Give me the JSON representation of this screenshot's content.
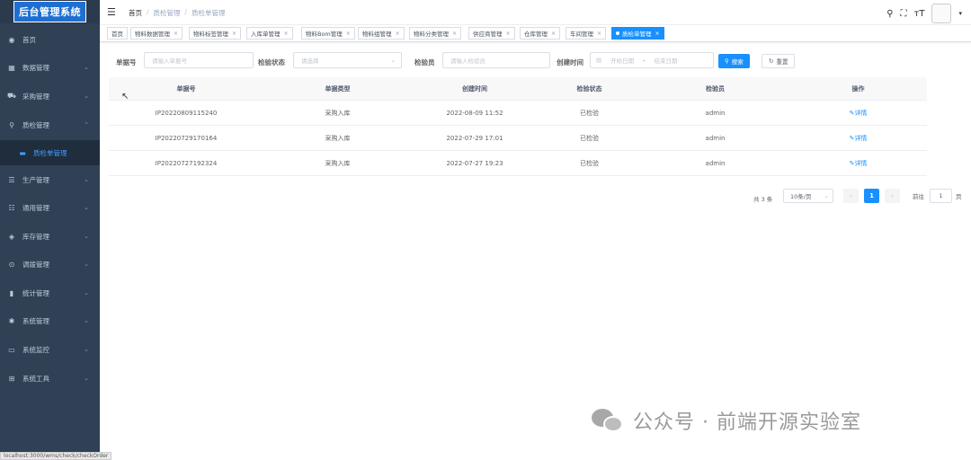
{
  "sidebar": {
    "logo": "后台管理系统",
    "items": [
      {
        "label": "首页",
        "icon": "dashboard-icon",
        "glyph": "◉",
        "chevron": false
      },
      {
        "label": "数据管理",
        "icon": "table-icon",
        "glyph": "▦",
        "chevron": true
      },
      {
        "label": "采购管理",
        "icon": "cart-icon",
        "glyph": "⛟",
        "chevron": true
      },
      {
        "label": "质检管理",
        "icon": "search-icon",
        "glyph": "⚲",
        "chevron": true,
        "expanded": true
      },
      {
        "label": "质检单管理",
        "icon": "document-icon",
        "glyph": "▬",
        "sub": true
      },
      {
        "label": "生产管理",
        "icon": "settings-sliders-icon",
        "glyph": "☰",
        "chevron": true
      },
      {
        "label": "通用管理",
        "icon": "list-icon",
        "glyph": "☷",
        "chevron": true
      },
      {
        "label": "库存管理",
        "icon": "layers-icon",
        "glyph": "◈",
        "chevron": true
      },
      {
        "label": "调拨管理",
        "icon": "transfer-icon",
        "glyph": "⊙",
        "chevron": true
      },
      {
        "label": "统计管理",
        "icon": "chart-icon",
        "glyph": "▮",
        "chevron": true
      },
      {
        "label": "系统管理",
        "icon": "gear-icon",
        "glyph": "✱",
        "chevron": true
      },
      {
        "label": "系统监控",
        "icon": "monitor-icon",
        "glyph": "▭",
        "chevron": true
      },
      {
        "label": "系统工具",
        "icon": "toolbox-icon",
        "glyph": "⊞",
        "chevron": true
      }
    ]
  },
  "navbar": {
    "breadcrumb": [
      "首页",
      "质检管理",
      "质检单管理"
    ],
    "sep": "/"
  },
  "tags": [
    {
      "label": "首页",
      "closable": false
    },
    {
      "label": "物料数据管理",
      "closable": true
    },
    {
      "label": "物料标签管理",
      "closable": true
    },
    {
      "label": "入库单管理",
      "closable": true
    },
    {
      "label": "物料Bom管理",
      "closable": true
    },
    {
      "label": "物料组管理",
      "closable": true
    },
    {
      "label": "物料分类管理",
      "closable": true
    },
    {
      "label": "供应商管理",
      "closable": true
    },
    {
      "label": "仓库管理",
      "closable": true
    },
    {
      "label": "车间管理",
      "closable": true
    },
    {
      "label": "质检单管理",
      "closable": true,
      "active": true
    }
  ],
  "search": {
    "order_no_label": "单据号",
    "order_no_placeholder": "请输入单据号",
    "status_label": "检验状态",
    "status_placeholder": "请选择",
    "inspector_label": "检验员",
    "inspector_placeholder": "请输入检验员",
    "time_label": "创建时间",
    "start_placeholder": "开始日期",
    "end_placeholder": "结束日期",
    "range_sep": "-",
    "search_btn": "搜索",
    "reset_btn": "重置"
  },
  "table": {
    "headers": [
      "单据号",
      "单据类型",
      "创建时间",
      "检验状态",
      "检验员",
      "操作"
    ],
    "rows": [
      [
        "IP20220809115240",
        "采购入库",
        "2022-08-09 11:52",
        "已检验",
        "admin",
        "详情"
      ],
      [
        "IP20220729170164",
        "采购入库",
        "2022-07-29 17:01",
        "已检验",
        "admin",
        "详情"
      ],
      [
        "IP20220727192324",
        "采购入库",
        "2022-07-27 19:23",
        "已检验",
        "admin",
        "详情"
      ]
    ]
  },
  "pagination": {
    "total": "共 3 条",
    "page_size": "10条/页",
    "current": "1",
    "goto_prefix": "前往",
    "goto_value": "1",
    "goto_suffix": "页"
  },
  "watermark": "公众号 · 前端开源实验室",
  "statusbar": "localhost:3000/wms/check/checkOrder"
}
